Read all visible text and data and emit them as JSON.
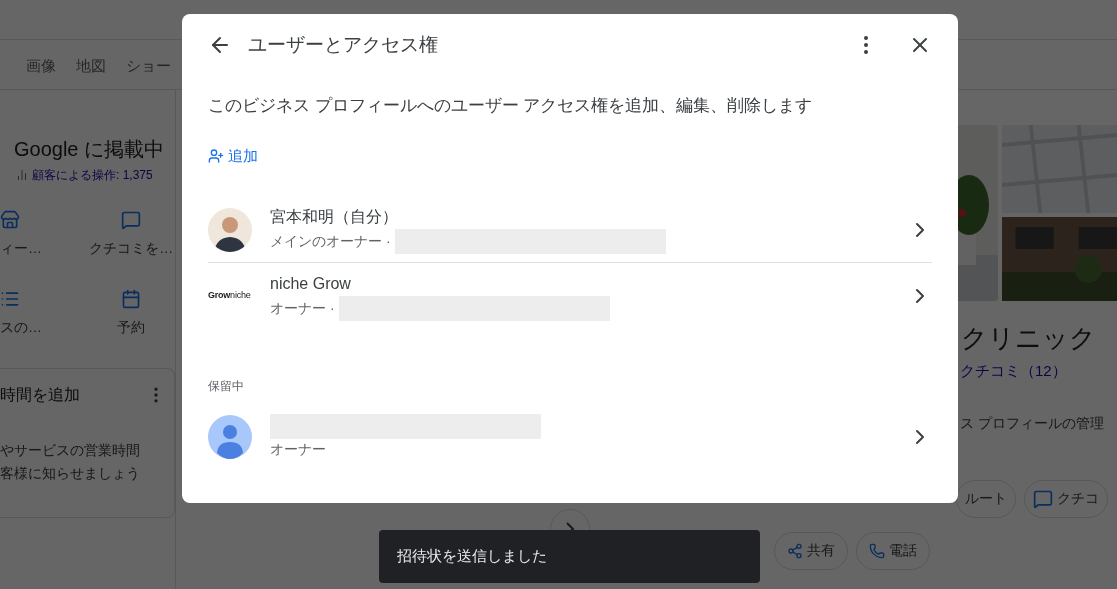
{
  "background": {
    "tabs": [
      {
        "label": "画像"
      },
      {
        "label": "地図"
      },
      {
        "label": "ショー"
      }
    ],
    "listing_title": "Google に掲載中",
    "stats": "顧客による操作: 1,375",
    "actions": [
      {
        "label": "ィー…",
        "kind": "store"
      },
      {
        "label": "クチコミを…",
        "kind": "review"
      },
      {
        "label": "スの…",
        "kind": "list"
      },
      {
        "label": "予約",
        "kind": "calendar"
      }
    ],
    "hours_card": {
      "title": "時間を追加",
      "lines": [
        "やサービスの営業時間",
        "客様に知らせましょう"
      ]
    },
    "place_name": "クリニック",
    "reviews_link": "クチコミ（12）",
    "manage_text": "ス プロフィールの管理",
    "buttons_row1": [
      {
        "label": "ルート"
      },
      {
        "label": "クチコ",
        "kind": "review"
      }
    ],
    "buttons_row2": [
      {
        "label": "共有",
        "kind": "share"
      },
      {
        "label": "電話",
        "kind": "phone"
      }
    ]
  },
  "dialog": {
    "title": "ユーザーとアクセス権",
    "description": "このビジネス プロフィールへのユーザー アクセス権を追加、編集、削除します",
    "add_label": "追加",
    "users": [
      {
        "name": "宮本和明（自分）",
        "role": "メインのオーナー ·",
        "redacted": true
      },
      {
        "kind": "logo",
        "logo_text": "**Grow**niche",
        "name": "niche Grow",
        "role": "オーナー ·",
        "redacted": true
      }
    ],
    "pending_heading": "保留中",
    "pending": [
      {
        "kind": "default",
        "role": "オーナー",
        "redacted": true
      }
    ]
  },
  "toast": "招待状を送信しました"
}
